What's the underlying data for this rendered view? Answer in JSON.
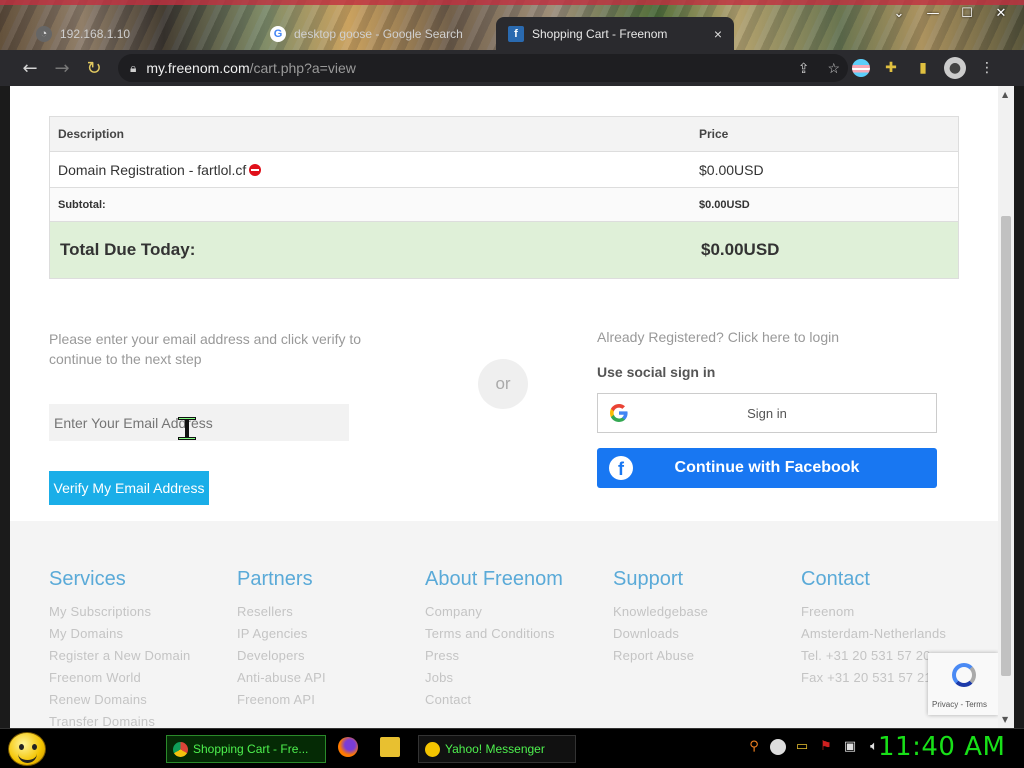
{
  "browser": {
    "tabs": [
      {
        "label": "192.168.1.10",
        "active": false
      },
      {
        "label": "desktop goose - Google Search",
        "active": false
      },
      {
        "label": "Shopping Cart - Freenom",
        "active": true
      }
    ],
    "url_host": "my.freenom.com",
    "url_path": "/cart.php?a=view",
    "tab_close": "×"
  },
  "cart": {
    "headers": {
      "description": "Description",
      "price": "Price"
    },
    "item": {
      "description": "Domain Registration - fartlol.cf",
      "price": "$0.00USD"
    },
    "subtotal": {
      "label": "Subtotal:",
      "value": "$0.00USD"
    },
    "total": {
      "label": "Total Due Today:",
      "value": "$0.00USD"
    }
  },
  "verify": {
    "instructions": "Please enter your email address and click verify to continue to the next step",
    "email_placeholder": "Enter Your Email Address",
    "button": "Verify My Email Address",
    "or": "or"
  },
  "login": {
    "link": "Already Registered? Click here to login",
    "social_title": "Use social sign in",
    "google": "Sign in",
    "facebook": "Continue with Facebook"
  },
  "footer": {
    "columns": [
      {
        "title": "Services",
        "links": [
          "My Subscriptions",
          "My Domains",
          "Register a New Domain",
          "Freenom World",
          "Renew Domains",
          "Transfer Domains"
        ]
      },
      {
        "title": "Partners",
        "links": [
          "Resellers",
          "IP Agencies",
          "Developers",
          "Anti-abuse API",
          "Freenom API"
        ]
      },
      {
        "title": "About Freenom",
        "links": [
          "Company",
          "Terms and Conditions",
          "Press",
          "Jobs",
          "Contact"
        ]
      },
      {
        "title": "Support",
        "links": [
          "Knowledgebase",
          "Downloads",
          "Report Abuse"
        ]
      },
      {
        "title": "Contact",
        "links": [
          "Freenom",
          "Amsterdam-Netherlands",
          "Tel. +31 20 531 57 20",
          "Fax +31 20 531 57 21"
        ]
      }
    ],
    "recaptcha_terms": "Privacy - Terms"
  },
  "taskbar": {
    "task_chrome": "Shopping Cart - Fre...",
    "task_yahoo": "Yahoo! Messenger",
    "clock": "11:40 AM"
  },
  "colors": {
    "accent": "#1aaee8",
    "facebook": "#1877f2",
    "total_bg": "#dff0d8",
    "footer_title": "#5aaad8",
    "clock": "#18e018"
  }
}
